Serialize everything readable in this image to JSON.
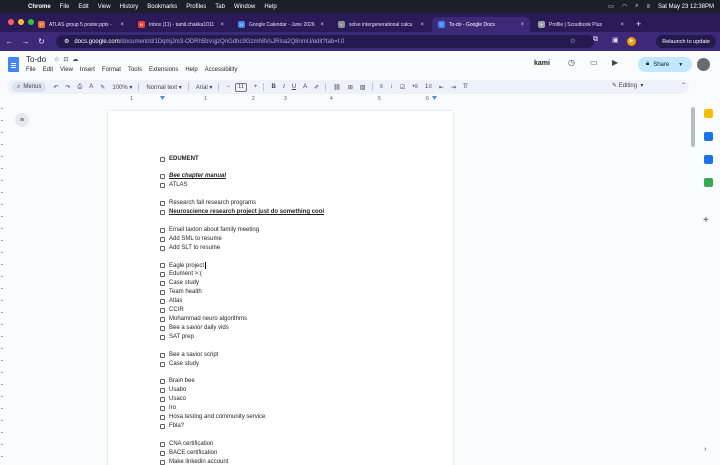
{
  "menubar": {
    "app": "Chrome",
    "items": [
      "File",
      "Edit",
      "View",
      "History",
      "Bookmarks",
      "Profiles",
      "Tab",
      "Window",
      "Help"
    ],
    "clock": "Sat May 23  12:38PM"
  },
  "tabs": [
    {
      "title": "ATLAS group 5 poster.pptx -",
      "favicon_color": "#e8743b"
    },
    {
      "title": "Inbox (11) - tamil.chakka1011",
      "favicon_color": "#ea4335"
    },
    {
      "title": "Google Calendar - June 2026",
      "favicon_color": "#4285f4"
    },
    {
      "title": "solve intergenerational calcu",
      "favicon_color": "#8a8f98"
    },
    {
      "title": "To-do - Google Docs",
      "favicon_color": "#4285f4",
      "active": true
    },
    {
      "title": "Profile | Scoutbook Plus",
      "favicon_color": "#9aa0a6"
    }
  ],
  "address": {
    "host": "docs.google.com",
    "path": "/document/d/1DqmjJm3-ODRh5bVqjzQnGdhc9Gzmh8VsJRlsa2Q8nmU/edit?tab=t.0"
  },
  "relaunch_label": "Relaunch to update",
  "doc": {
    "title": "To-do",
    "menu": [
      "File",
      "Edit",
      "View",
      "Insert",
      "Format",
      "Tools",
      "Extensions",
      "Help",
      "Accessibility"
    ],
    "kami_label": "kami",
    "share_label": "Share"
  },
  "toolbar": {
    "menus_label": "Menus",
    "zoom": "100%",
    "style": "Normal text",
    "font": "Arial",
    "font_size": "11",
    "mode": "Editing"
  },
  "ruler_numbers": [
    "1",
    "1",
    "2",
    "3",
    "4",
    "5",
    "6",
    "7"
  ],
  "checklist": [
    {
      "text": "EDUMENT",
      "style": "bold"
    },
    {
      "text": "Bee chapter manual",
      "style": "bi"
    },
    {
      "text": "ATLAS",
      "style": "normal"
    },
    {
      "text": "Research fall research programs",
      "style": "normal"
    },
    {
      "text": "Neuroscience research project just do something cool",
      "style": "bu"
    },
    {
      "text": "Email taxton about family meeting",
      "style": "normal"
    },
    {
      "text": "Add SML to resume",
      "style": "normal"
    },
    {
      "text": "Add SLT to resume",
      "style": "normal"
    },
    {
      "text": "Eagle project",
      "style": "normal",
      "cursor": true
    },
    {
      "text": "Edument >:(",
      "style": "normal"
    },
    {
      "text": "Case study",
      "style": "normal"
    },
    {
      "text": "Team health",
      "style": "normal"
    },
    {
      "text": "Atlas",
      "style": "normal"
    },
    {
      "text": "CCIR",
      "style": "normal"
    },
    {
      "text": "Mohammad neuro algorithms",
      "style": "normal"
    },
    {
      "text": "Bee a savior daily vids",
      "style": "normal"
    },
    {
      "text": "SAT prep",
      "style": "normal"
    },
    {
      "text": "Bee a savior script",
      "style": "normal"
    },
    {
      "text": "Case study",
      "style": "normal"
    },
    {
      "text": "Brain bee",
      "style": "normal"
    },
    {
      "text": "Usabo",
      "style": "normal"
    },
    {
      "text": "Usaco",
      "style": "normal"
    },
    {
      "text": "Iro",
      "style": "normal"
    },
    {
      "text": "Hosa testing and community service",
      "style": "normal"
    },
    {
      "text": "Fbla?",
      "style": "normal"
    },
    {
      "text": "CNA certification",
      "style": "normal"
    },
    {
      "text": "BACE certification",
      "style": "normal"
    },
    {
      "text": "Make linkedin account",
      "style": "normal"
    }
  ],
  "side_panel": [
    {
      "icon": "keep-icon",
      "color": "#fbbc04"
    },
    {
      "icon": "tasks-icon",
      "color": "#1a73e8"
    },
    {
      "icon": "contacts-icon",
      "color": "#1a73e8"
    },
    {
      "icon": "maps-icon",
      "color": "#34a853"
    }
  ]
}
